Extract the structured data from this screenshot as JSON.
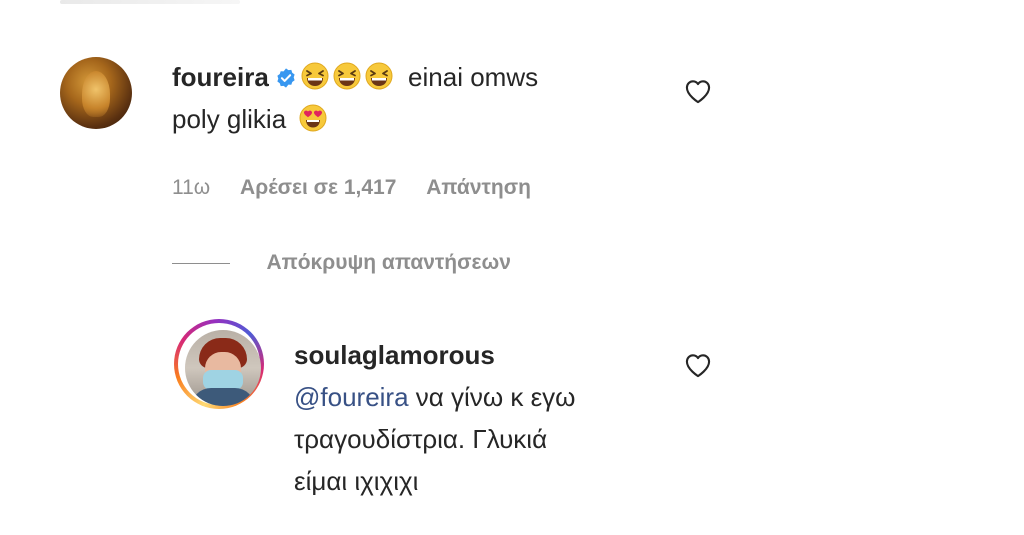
{
  "comment1": {
    "username": "foureira",
    "text_after_emojis": "einai omws",
    "line2": "poly glikia",
    "age": "11ω",
    "likes": "Αρέσει σε 1,417",
    "reply": "Απάντηση"
  },
  "hide_replies": "Απόκρυψη απαντήσεων",
  "reply1": {
    "username": "soulaglamorous",
    "mention": "@foureira",
    "line1_rest": "να γίνω κ εγω",
    "line2": "τραγουδίστρια. Γλυκιά",
    "line3": "είμαι ιχιχιχι"
  },
  "icons": {
    "verified": "verified-badge-icon",
    "laugh": "grinning-squinting-face-icon",
    "heart_eyes": "heart-eyes-face-icon",
    "like": "heart-outline-icon"
  },
  "colors": {
    "text": "#262626",
    "muted": "#8e8e8e",
    "mention": "#385185",
    "verified": "#3897f0"
  }
}
